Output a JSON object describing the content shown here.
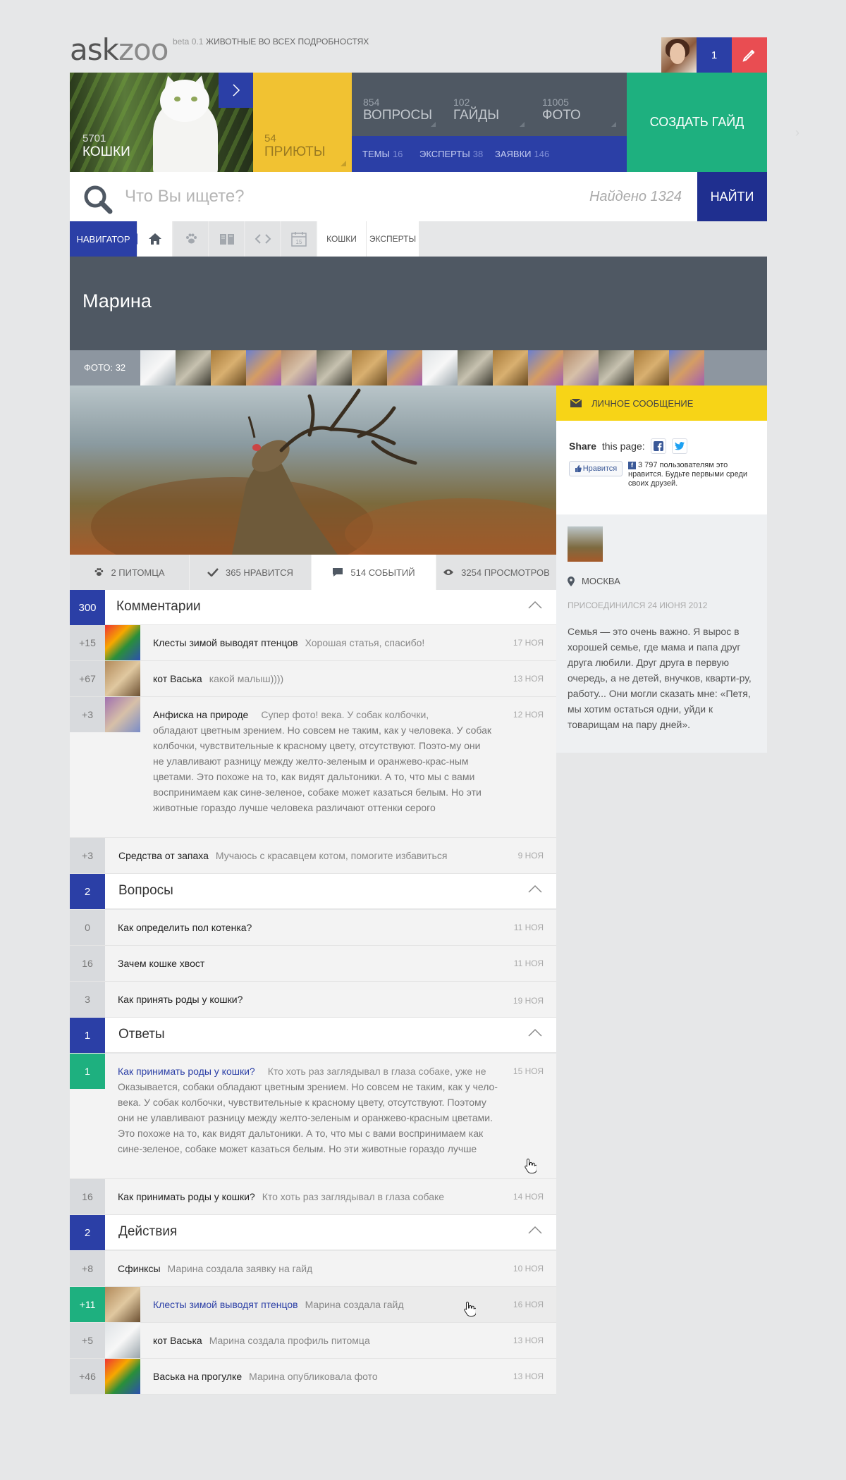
{
  "header": {
    "logo_ask": "ask",
    "logo_zoo": "zoo",
    "beta": "beta 0.1",
    "slogan": "ЖИВОТНЫЕ ВО ВСЕХ ПОДРОБНОСТЯХ",
    "notifications": "1",
    "user_avatar_icon": "user-avatar",
    "compose_icon": "pencil-icon"
  },
  "tiles": {
    "cats": {
      "count": "5701",
      "label": "КОШКИ"
    },
    "shelters": {
      "count": "54",
      "label": "ПРИЮТЫ"
    },
    "questions": {
      "count": "854",
      "label": "ВОПРОСЫ"
    },
    "guides": {
      "count": "102",
      "label": "ГАЙДЫ"
    },
    "photos": {
      "count": "11005",
      "label": "ФОТО"
    },
    "subnav": [
      {
        "label": "ТЕМЫ",
        "count": "16"
      },
      {
        "label": "ЭКСПЕРТЫ",
        "count": "38"
      },
      {
        "label": "ЗАЯВКИ",
        "count": "146"
      }
    ],
    "create": "СОЗДАТЬ ГАЙД"
  },
  "search": {
    "placeholder": "Что Вы ищете?",
    "found": "Найдено 1324",
    "button": "НАЙТИ"
  },
  "navigator": {
    "label": "НАВИГАТОР",
    "calendar_day": "15",
    "crumbs": [
      "КОШКИ",
      "ЭКСПЕРТЫ"
    ]
  },
  "profile": {
    "name": "Марина",
    "photos_label": "ФОТО: 32"
  },
  "stats": {
    "pets": "2 ПИТОМЦА",
    "likes": "365 НРАВИТСЯ",
    "events": "514 СОБЫТИЙ",
    "views": "3254 ПРОСМОТРОВ"
  },
  "sidebar": {
    "message": "ЛИЧНОЕ СООБЩЕНИЕ",
    "share_bold": "Share",
    "share_rest": "this page:",
    "like_button": "Нравится",
    "like_text": "3 797 пользователям это нравится. Будьте первыми среди своих друзей.",
    "city": "МОСКВА",
    "joined": "ПРИСОЕДИНИЛСЯ 24 ИЮНЯ 2012",
    "bio": "Семья — это очень важно. Я вырос в хорошей семье, где мама и папа друг друга любили. Друг друга в первую очередь, а не детей, внучков, кварти-ру, работу... Они могли сказать мне: «Петя, мы хотим остаться одни, уйди к товарищам на пару дней»."
  },
  "comments": {
    "count": "300",
    "title": "Комментарии",
    "items": [
      {
        "score": "+15",
        "title": "Клесты зимой выводят птенцов",
        "text": "Хорошая статья, спасибо!",
        "date": "17 НОЯ"
      },
      {
        "score": "+67",
        "title": "кот Васька",
        "text": "какой малыш))))",
        "date": "13 НОЯ"
      },
      {
        "score": "+3",
        "title": "Анфиска на природе",
        "text": "Супер фото! века. У собак колбочки,",
        "text_more": "обладают цветным зрением. Но совсем не таким, как у человека. У собак колбочки, чувствительные к красному цвету, отсутствуют. Поэто-му они не улавливают разницу между желто-зеленым и оранжево-крас-ным цветами. Это похоже на то, как видят дальтоники. А то, что мы с вами воспринимаем как сине-зеленое, собаке может казаться белым. Но эти животные гораздо лучше человека различают оттенки серого",
        "date": "12 НОЯ"
      },
      {
        "score": "+3",
        "title": "Средства от запаха",
        "text": "Мучаюсь с красавцем котом, помогите избавиться",
        "date": "9 НОЯ"
      }
    ]
  },
  "questions": {
    "count": "2",
    "title": "Вопросы",
    "items": [
      {
        "score": "0",
        "title": "Как определить пол котенка?",
        "date": "11 НОЯ"
      },
      {
        "score": "16",
        "title": "Зачем кошке хвост",
        "date": "11 НОЯ"
      },
      {
        "score": "3",
        "title": "Как принять роды у кошки?",
        "date": "19 НОЯ"
      }
    ]
  },
  "answers": {
    "count": "1",
    "title": "Ответы",
    "items": [
      {
        "score": "1",
        "title": "Как принимать роды у кошки?",
        "text": "Кто хоть раз заглядывал в глаза собаке, уже не",
        "text_more": "Оказывается, собаки обладают цветным зрением. Но совсем не таким, как у чело-века. У собак колбочки, чувствительные к красному цвету, отсутствуют. Поэтому они не улавливают разницу между желто-зеленым и оранжево-красным цветами. Это похоже на то, как видят дальтоники. А то, что мы с вами воспринимаем как сине-зеленое, собаке может казаться белым. Но эти животные гораздо лучше",
        "date": "15 НОЯ"
      },
      {
        "score": "16",
        "title": "Как принимать роды у кошки?",
        "text": "Кто хоть раз заглядывал в глаза собаке",
        "date": "14 НОЯ"
      }
    ]
  },
  "actions": {
    "count": "2",
    "title": "Действия",
    "items": [
      {
        "score": "+8",
        "title": "Сфинксы",
        "text": "Марина создала заявку на гайд",
        "date": "10 НОЯ"
      },
      {
        "score": "+11",
        "title": "Клесты зимой выводят птенцов",
        "text": "Марина создала гайд",
        "date": "16 НОЯ"
      },
      {
        "score": "+5",
        "title": "кот Васька",
        "text": "Марина создала профиль питомца",
        "date": "13 НОЯ"
      },
      {
        "score": "+46",
        "title": "Васька на прогулке",
        "text": "Марина опубликовала фото",
        "date": "13 НОЯ"
      }
    ]
  },
  "colors": {
    "blue": "#2b3fa6",
    "dark_blue": "#1f2f8f",
    "green": "#1eb07f",
    "yellow": "#f1c232",
    "slate": "#4f5863",
    "red": "#e94d52"
  }
}
